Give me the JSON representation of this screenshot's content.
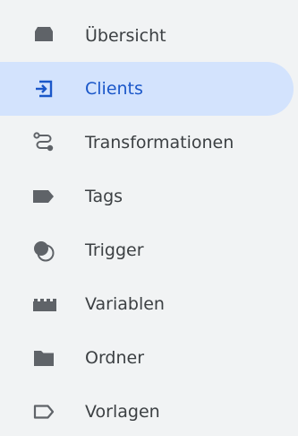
{
  "accent_color": "#1a57c9",
  "active_background": "#d3e3fd",
  "nav": {
    "items": [
      {
        "label": "Übersicht",
        "icon": "inbox-tray-icon",
        "active": false
      },
      {
        "label": "Clients",
        "icon": "login-arrow-icon",
        "active": true
      },
      {
        "label": "Transformationen",
        "icon": "route-icon",
        "active": false
      },
      {
        "label": "Tags",
        "icon": "tag-icon",
        "active": false
      },
      {
        "label": "Trigger",
        "icon": "trigger-circles-icon",
        "active": false
      },
      {
        "label": "Variablen",
        "icon": "lego-brick-icon",
        "active": false
      },
      {
        "label": "Ordner",
        "icon": "folder-icon",
        "active": false
      },
      {
        "label": "Vorlagen",
        "icon": "tag-outline-icon",
        "active": false
      }
    ]
  }
}
